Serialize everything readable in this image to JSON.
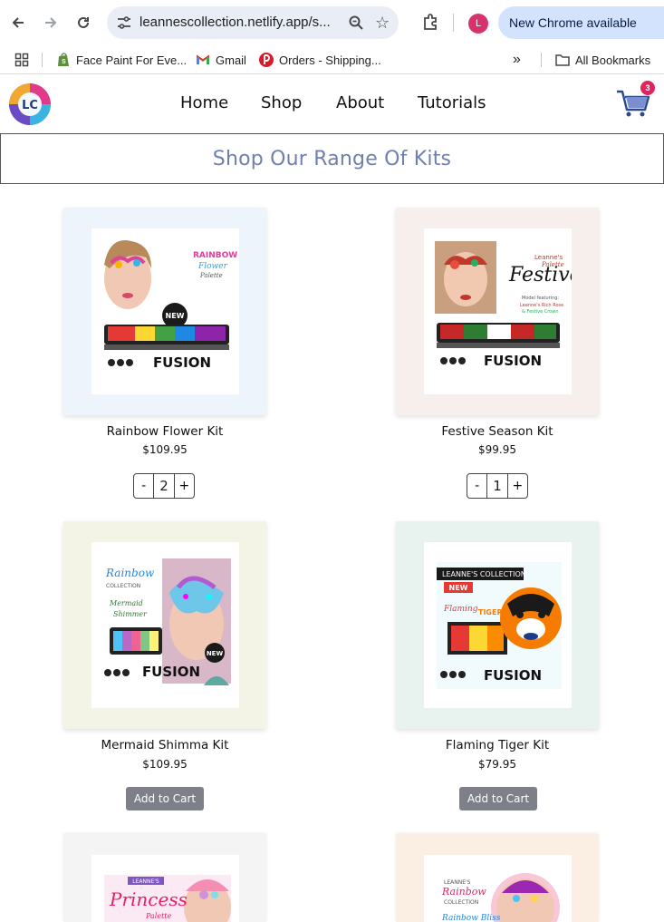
{
  "browser": {
    "url": "leannescollection.netlify.app/s...",
    "profile_initial": "L",
    "update_label": "New Chrome available",
    "bookmarks": [
      {
        "label": "Face Paint For Eve..."
      },
      {
        "label": "Gmail"
      },
      {
        "label": "Orders - Shipping..."
      }
    ],
    "all_bookmarks_label": "All Bookmarks",
    "overflow_label": "»"
  },
  "site": {
    "logo_text": "LC",
    "nav": [
      "Home",
      "Shop",
      "About",
      "Tutorials"
    ],
    "cart_count": "3",
    "page_title": "Shop Our Range Of Kits"
  },
  "products": [
    {
      "name": "Rainbow Flower Kit",
      "price": "$109.95",
      "qty": "2",
      "bg": "#eef4fc",
      "action": "stepper"
    },
    {
      "name": "Festive Season Kit",
      "price": "$99.95",
      "qty": "1",
      "bg": "#f6efec",
      "action": "stepper"
    },
    {
      "name": "Mermaid Shimma Kit",
      "price": "$109.95",
      "bg": "#f3f4e6",
      "action": "add",
      "action_label": "Add to Cart"
    },
    {
      "name": "Flaming Tiger Kit",
      "price": "$79.95",
      "bg": "#e8f2ef",
      "action": "add",
      "action_label": "Add to Cart"
    },
    {
      "bg": "#f4f4f4"
    },
    {
      "bg": "#fbeee3"
    }
  ],
  "stepper": {
    "minus": "-",
    "plus": "+"
  }
}
